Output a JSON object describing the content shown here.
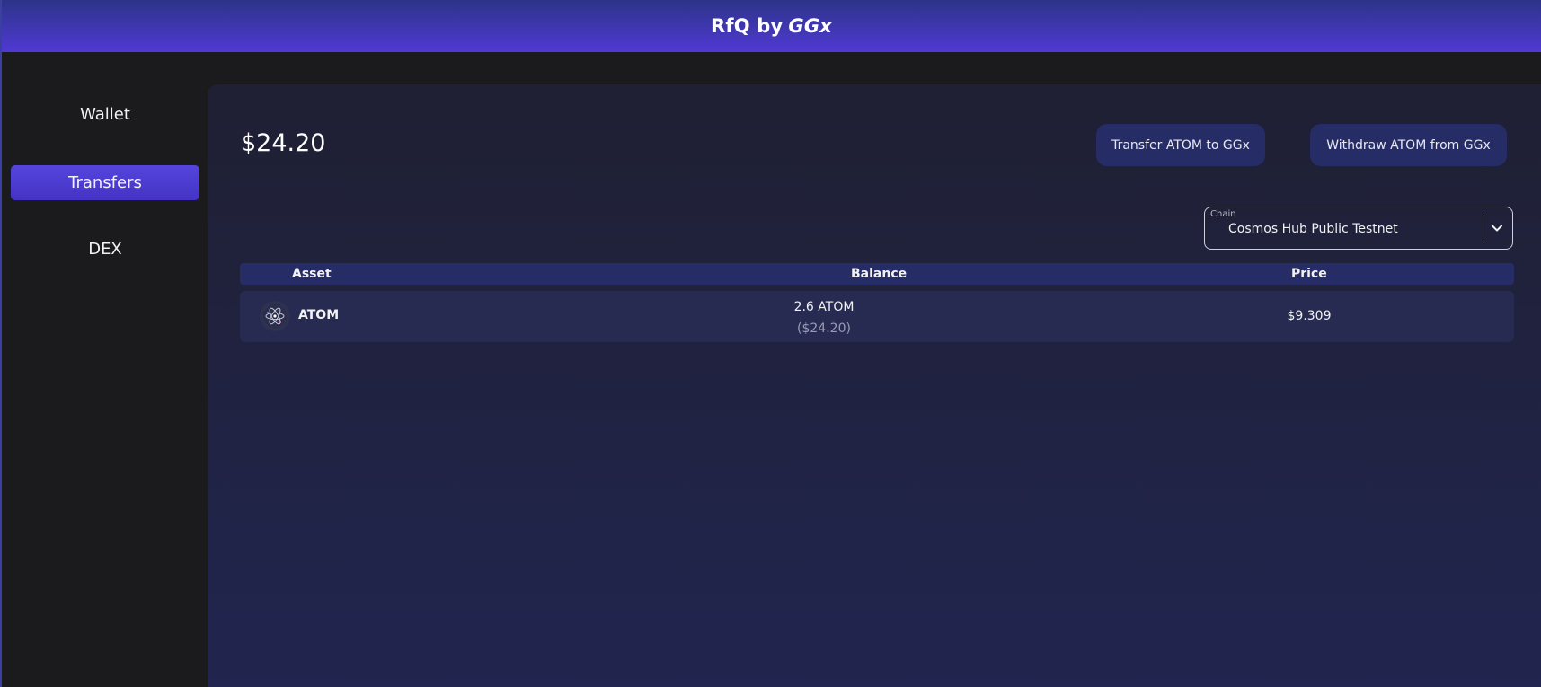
{
  "header": {
    "title_prefix": "RfQ by",
    "title_brand": "GGx"
  },
  "sidebar": {
    "items": [
      {
        "label": "Wallet",
        "active": false
      },
      {
        "label": "Transfers",
        "active": true
      },
      {
        "label": "DEX",
        "active": false
      }
    ]
  },
  "main": {
    "total_balance": "$24.20",
    "buttons": {
      "transfer_label": "Transfer ATOM to GGx",
      "withdraw_label": "Withdraw ATOM from GGx"
    },
    "chain_select": {
      "label": "Chain",
      "value": "Cosmos Hub Public Testnet",
      "icon": "chevron-down-icon"
    },
    "table": {
      "columns": [
        "Asset",
        "Balance",
        "Price"
      ],
      "rows": [
        {
          "icon": "cosmos-atom-icon",
          "asset": "ATOM",
          "balance": "2.6 ATOM",
          "balance_usd": "($24.20)",
          "price": "$9.309"
        }
      ]
    }
  },
  "colors": {
    "header_gradient_top": "#2c3488",
    "header_gradient_bottom": "#5039d4",
    "accent": "#4d3ed6",
    "button_bg": "#262c66",
    "panel_bg": "#1f2033"
  }
}
